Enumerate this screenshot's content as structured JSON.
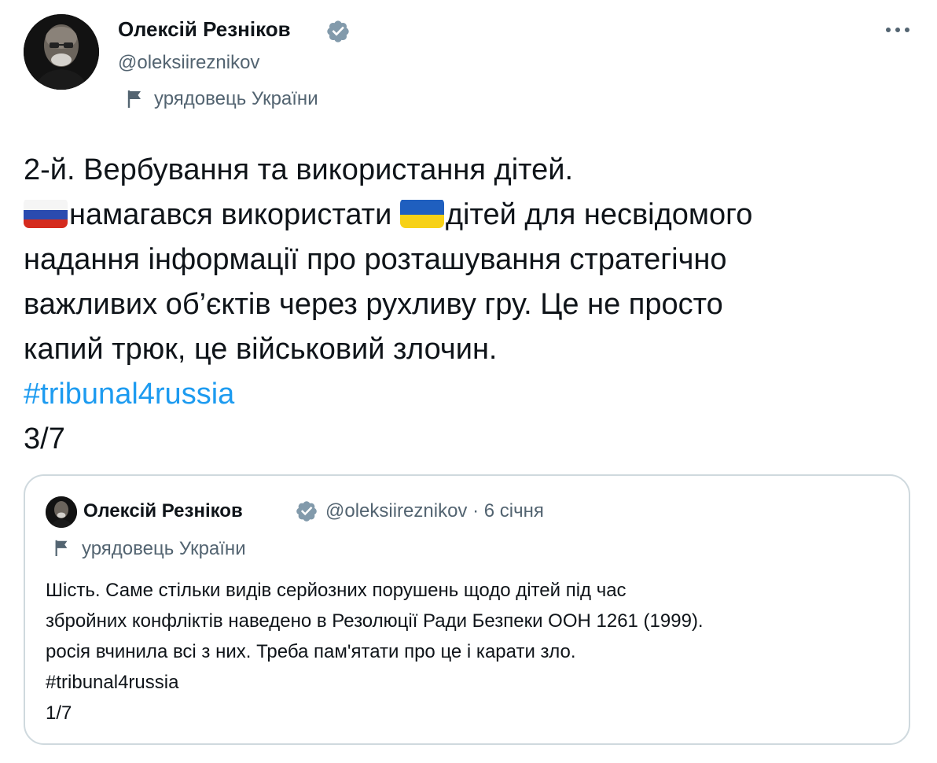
{
  "author": {
    "display_name": "Олексій Резніков",
    "handle": "@oleksiireznikov",
    "label": "урядовець України",
    "verified_icon": "verified-badge-icon",
    "label_icon": "flag-icon"
  },
  "more_icon": "more-options-icon",
  "tweet": {
    "line1": "2-й. Вербування та використання дітей.",
    "line2_flag1": "russia-flag-emoji",
    "line2_part1": "намагався використати ",
    "line2_flag2": "ukraine-flag-emoji",
    "line2_part2": "дітей для несвідомого",
    "line3": "надання інформації про розташування стратегічно",
    "line4": "важливих об’єктів через рухливу гру. Це не просто",
    "line5": "капий трюк, це військовий злочин.",
    "hashtag": "#tribunal4russia",
    "counter": "3/7"
  },
  "quoted_tweet": {
    "display_name": "Олексій Резніков",
    "handle": "@oleksiireznikov",
    "separator": " · ",
    "date": "6 січня",
    "label": "урядовець України",
    "line1": "Шість. Саме стільки видів серйозних порушень щодо дітей під час",
    "line2": "збройних конфліктів наведено в Резолюції Ради Безпеки ООН 1261 (1999).",
    "line3": "росія вчинила всі з них. Треба пам'ятати про це і карати зло.",
    "hashtag": "#tribunal4russia",
    "counter": "1/7"
  },
  "colors": {
    "text": "#0f1419",
    "secondary": "#536471",
    "link": "#1d9bf0",
    "verified": "#829aab",
    "border": "#cfd9de"
  }
}
